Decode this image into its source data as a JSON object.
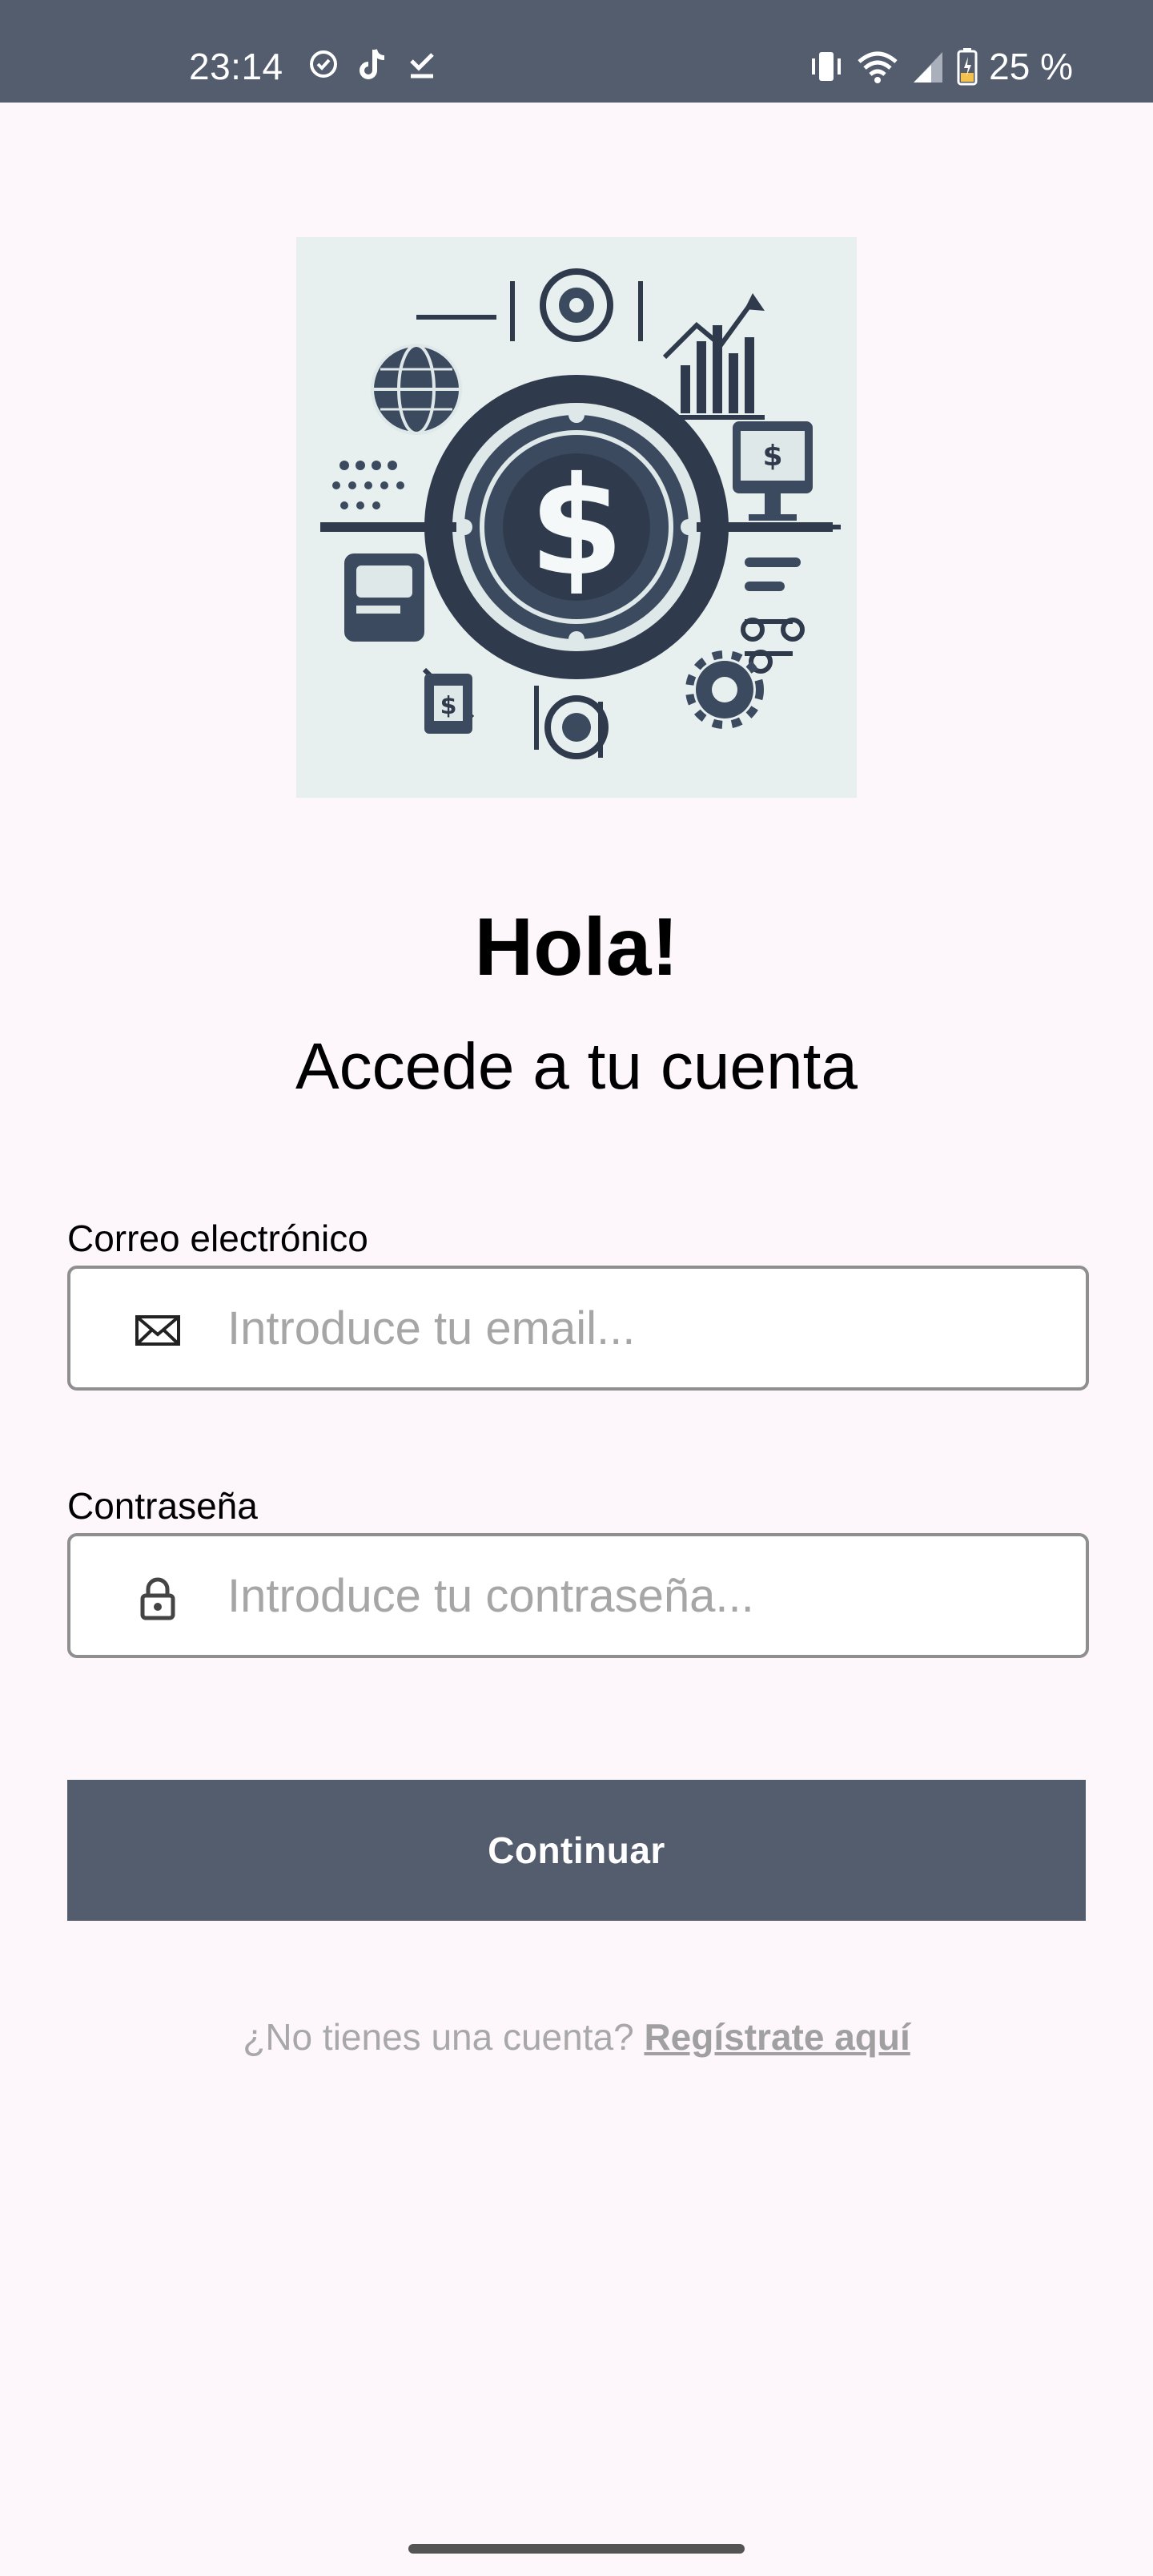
{
  "status_bar": {
    "time": "23:14",
    "battery": "25 %",
    "icons": [
      "check-circle-icon",
      "tiktok-icon",
      "download-done-icon",
      "vibrate-icon",
      "wifi-icon",
      "signal-icon",
      "battery-icon"
    ]
  },
  "logo": {
    "icon": "finance-dollar-logo"
  },
  "login": {
    "greeting": "Hola!",
    "subtitle": "Accede a tu cuenta",
    "email_label": "Correo electrónico",
    "email_placeholder": "Introduce tu email...",
    "email_value": "",
    "password_label": "Contraseña",
    "password_placeholder": "Introduce tu contraseña...",
    "password_value": "",
    "continue_label": "Continuar",
    "register_prompt": "¿No tienes una cuenta?",
    "register_link": "Regístrate aquí"
  },
  "colors": {
    "background": "#fdf7fc",
    "primary": "#545d6e",
    "logo_background": "#e7efef"
  }
}
